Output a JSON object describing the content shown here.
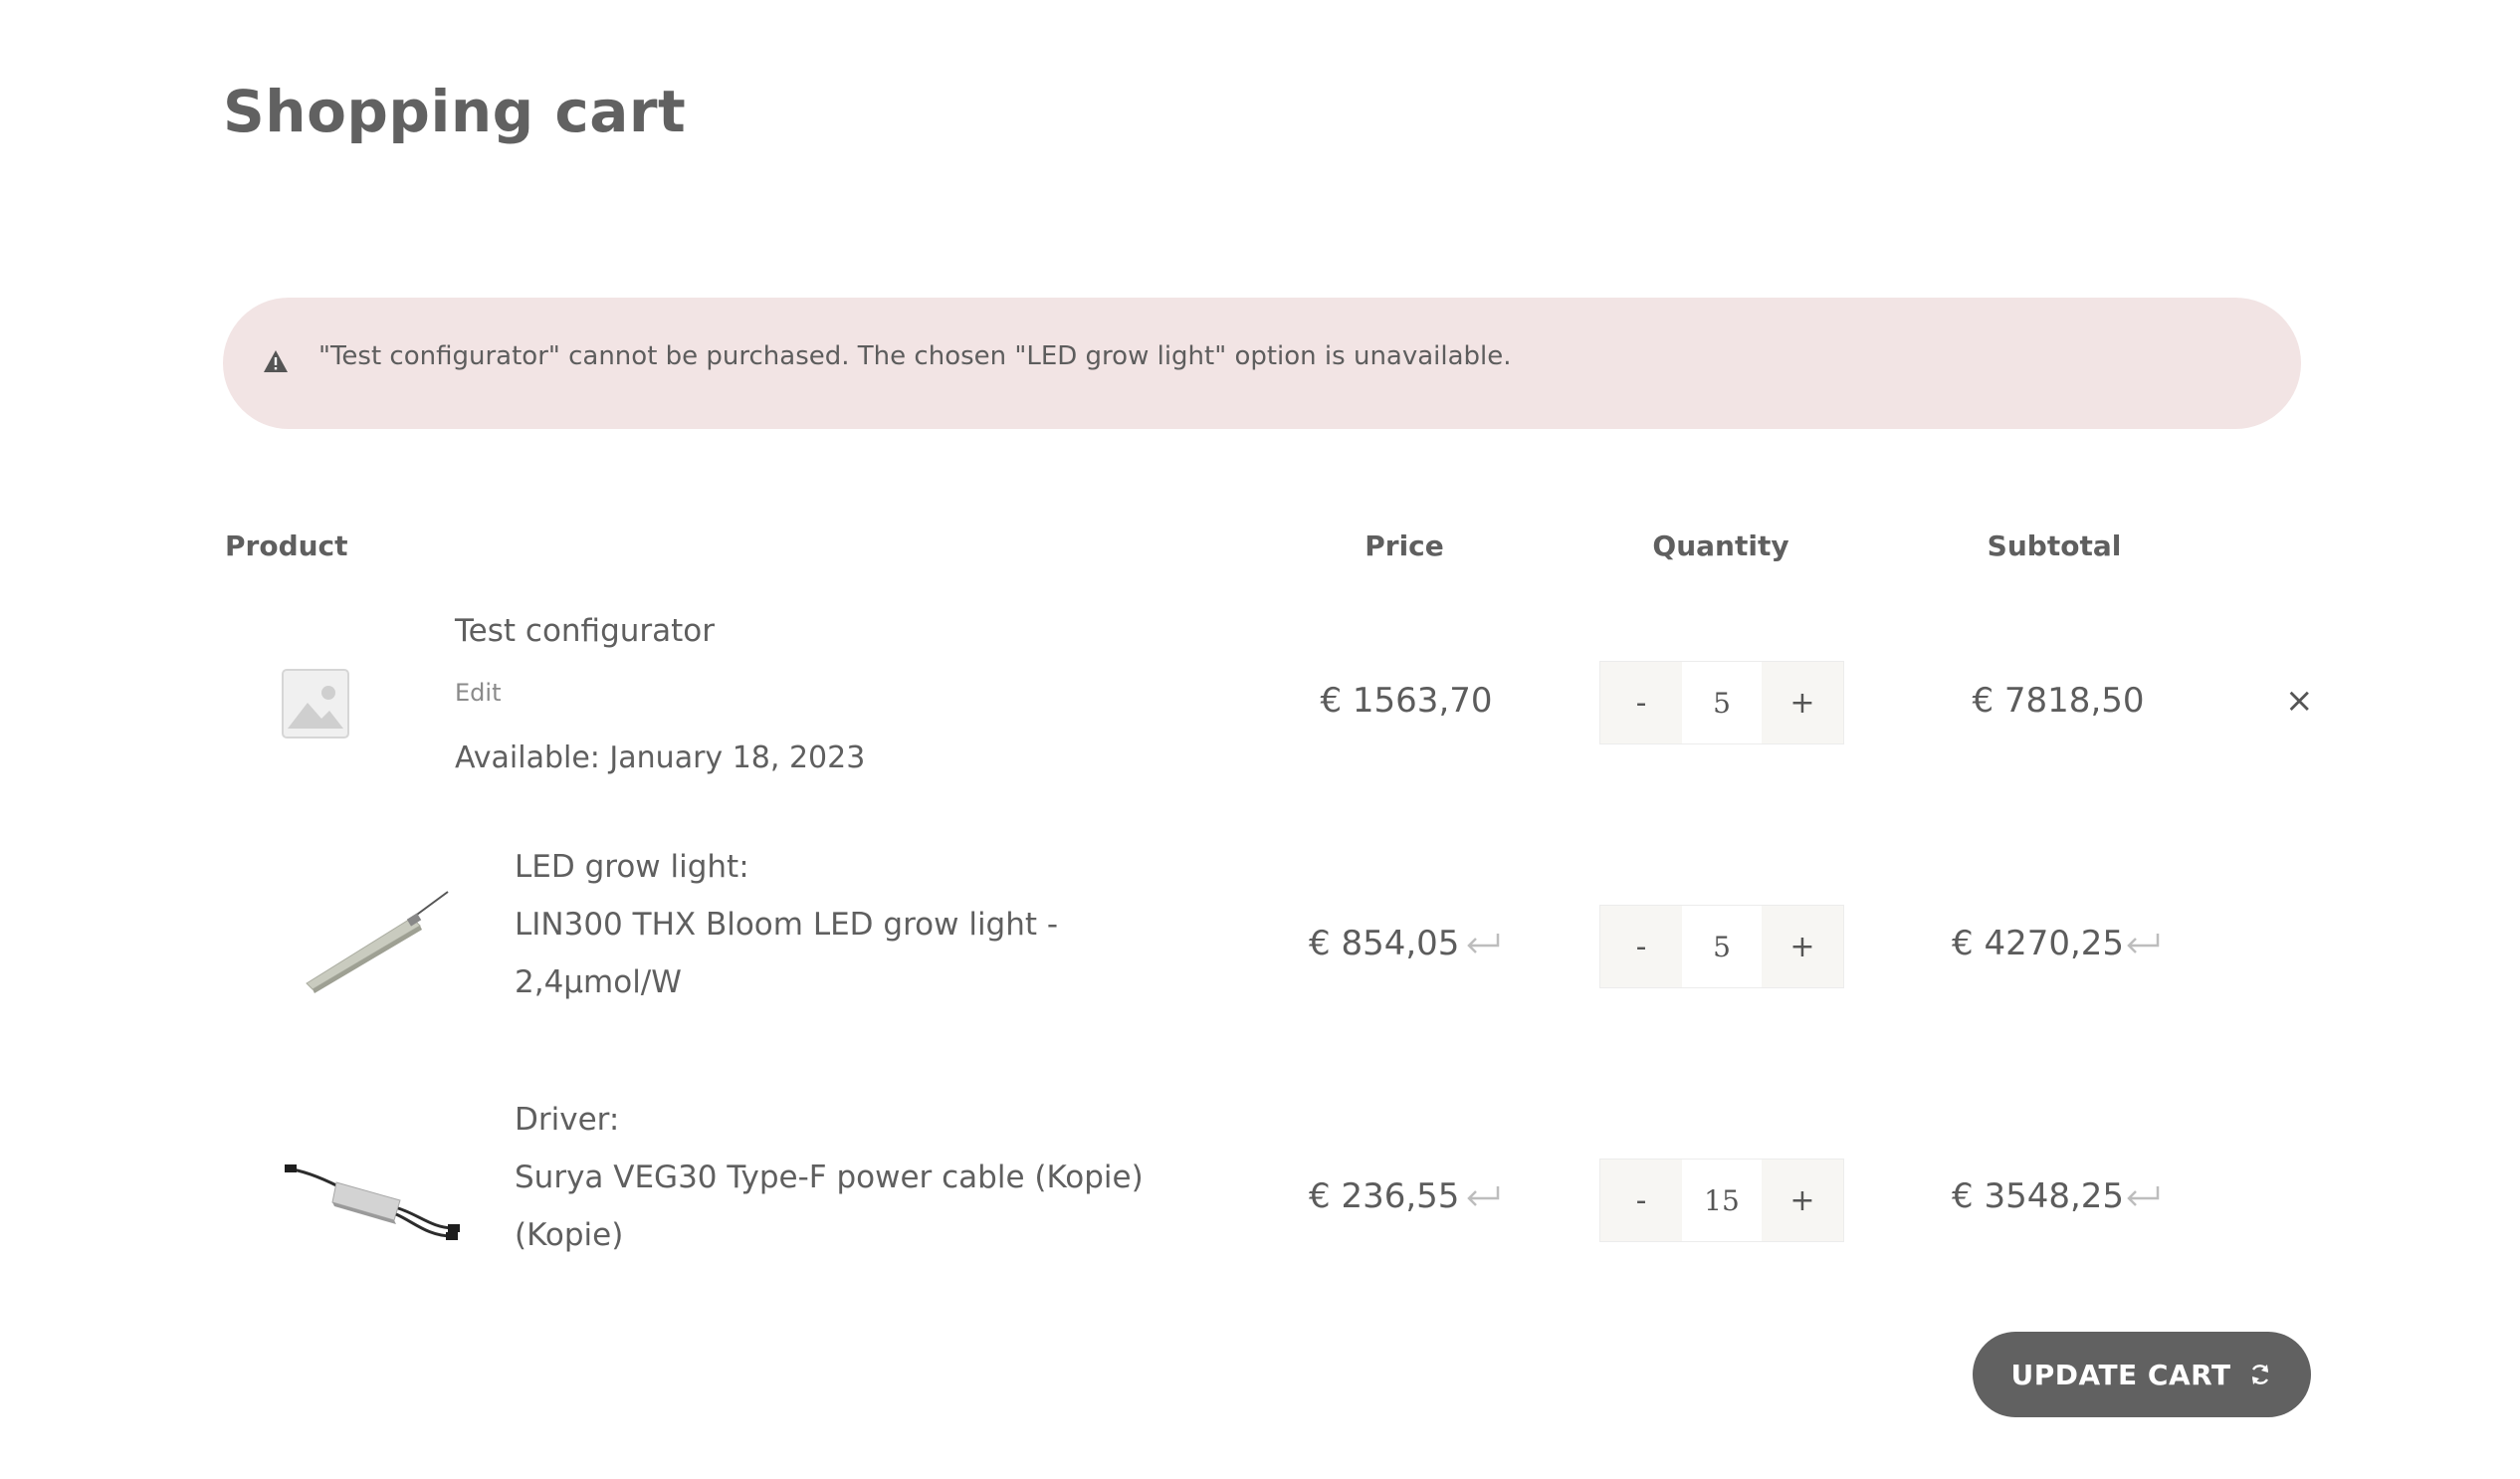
{
  "page": {
    "title": "Shopping cart"
  },
  "notice": {
    "icon": "warning-icon",
    "message": "\"Test configurator\" cannot be purchased. The chosen \"LED grow light\" option is unavailable."
  },
  "table": {
    "headers": {
      "product": "Product",
      "price": "Price",
      "quantity": "Quantity",
      "subtotal": "Subtotal"
    }
  },
  "main_item": {
    "name": "Test configurator",
    "edit_label": "Edit",
    "available": "Available: January 18, 2023",
    "price": "€ 1563,70",
    "quantity": "5",
    "subtotal": "€ 7818,50",
    "remove_label": "×"
  },
  "sub_items": [
    {
      "option_label": "LED grow light:",
      "product_line1": "LIN300 THX Bloom LED grow light -",
      "product_line2": "2,4μmol/W",
      "price": "€ 854,05",
      "quantity": "5",
      "subtotal": "€ 4270,25"
    },
    {
      "option_label": "Driver:",
      "product_line1": "Surya VEG30 Type-F power cable (Kopie)",
      "product_line2": "(Kopie)",
      "price": "€ 236,55",
      "quantity": "15",
      "subtotal": "€ 3548,25"
    }
  ],
  "qty_controls": {
    "minus": "-",
    "plus": "+"
  },
  "actions": {
    "update_cart": "UPDATE CART"
  },
  "colors": {
    "notice_bg": "#f2e4e4",
    "button_bg": "#616161",
    "text": "#5f5f5f"
  }
}
